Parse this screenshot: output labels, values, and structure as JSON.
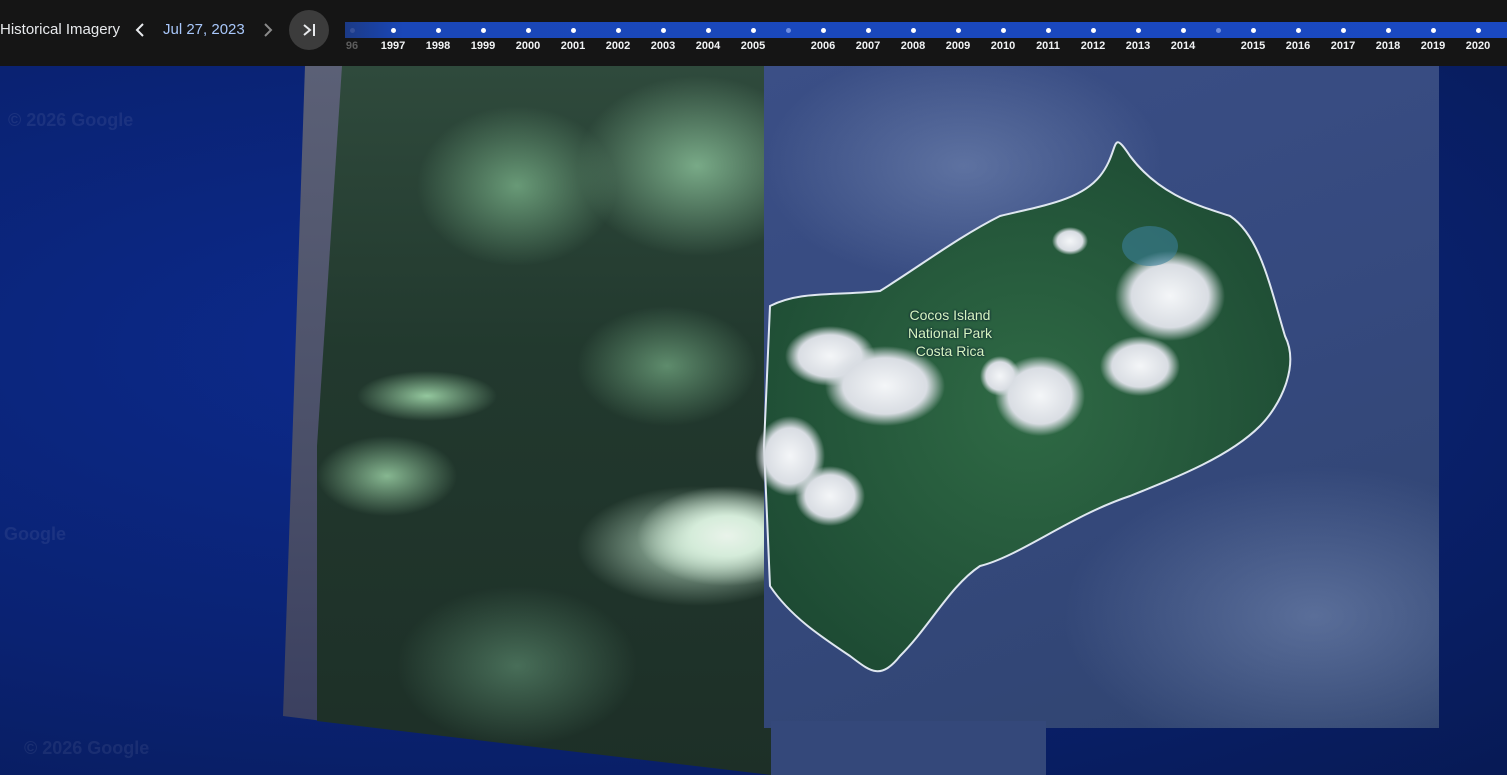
{
  "toolbar": {
    "title": "Historical Imagery",
    "date": "Jul 27, 2023",
    "prev_icon": "chevron-left-icon",
    "next_icon": "chevron-right-icon",
    "latest_icon": "skip-to-latest-icon"
  },
  "timeline": {
    "years": [
      {
        "label": "96",
        "faded": true
      },
      {
        "label": "1997"
      },
      {
        "label": "1998"
      },
      {
        "label": "1999"
      },
      {
        "label": "2000"
      },
      {
        "label": "2001"
      },
      {
        "label": "2002"
      },
      {
        "label": "2003"
      },
      {
        "label": "2004"
      },
      {
        "label": "2005"
      },
      {
        "label": "2006"
      },
      {
        "label": "2007"
      },
      {
        "label": "2008"
      },
      {
        "label": "2009"
      },
      {
        "label": "2010"
      },
      {
        "label": "2011"
      },
      {
        "label": "2012"
      },
      {
        "label": "2013"
      },
      {
        "label": "2014"
      },
      {
        "label": "2015"
      },
      {
        "label": "2016"
      },
      {
        "label": "2017"
      },
      {
        "label": "2018"
      },
      {
        "label": "2019"
      },
      {
        "label": "2020"
      }
    ],
    "colors": {
      "track": "#1a49c2",
      "tick": "#ffffff"
    }
  },
  "map": {
    "place_label": [
      "Cocos Island",
      "National Park",
      "Costa Rica"
    ],
    "watermarks": [
      "© 2026 Google",
      "Google",
      "© 2026 Google"
    ]
  }
}
